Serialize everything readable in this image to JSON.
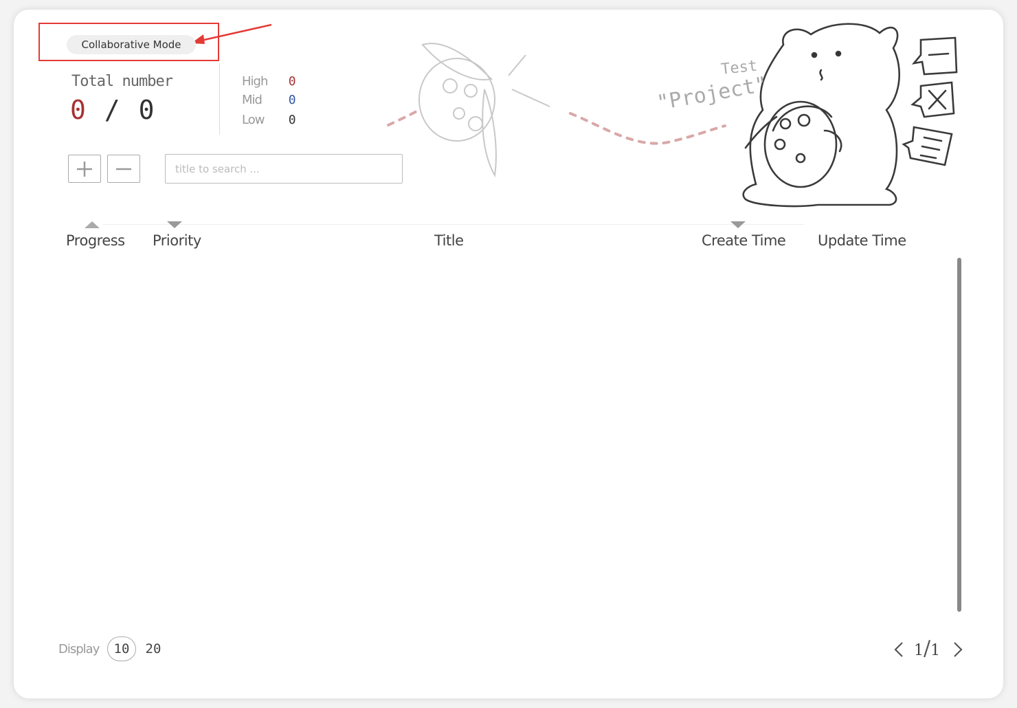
{
  "header": {
    "mode_button": "Collaborative Mode",
    "total_label": "Total number",
    "total_done": "0",
    "total_separator": "/",
    "total_all": "0",
    "priorities": [
      {
        "label": "High",
        "count": "0",
        "color": "#a63232"
      },
      {
        "label": "Mid",
        "count": "0",
        "color": "#2f55a4"
      },
      {
        "label": "Low",
        "count": "0",
        "color": "#333333"
      }
    ]
  },
  "toolbar": {
    "add_icon": "plus-icon",
    "remove_icon": "minus-icon",
    "search_placeholder": "title to search ..."
  },
  "illustration": {
    "line1": "Test",
    "line2": "\"Project\""
  },
  "table": {
    "columns": [
      {
        "label": "Progress",
        "sort": "asc"
      },
      {
        "label": "Priority",
        "sort": "desc"
      },
      {
        "label": "Title",
        "sort": "none"
      },
      {
        "label": "Create Time",
        "sort": "desc"
      },
      {
        "label": "Update Time",
        "sort": "none"
      }
    ],
    "rows": []
  },
  "footer": {
    "display_label": "Display",
    "page_sizes": [
      "10",
      "20"
    ],
    "selected_size": "10",
    "page_current": "1",
    "page_sep": "/",
    "page_total": "1"
  },
  "colors": {
    "annotation": "#e53935",
    "high": "#a63232",
    "mid": "#2f55a4"
  }
}
